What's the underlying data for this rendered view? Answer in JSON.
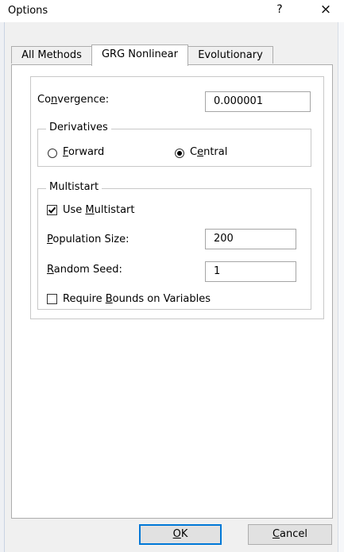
{
  "window": {
    "title": "Options",
    "help_label": "?",
    "close_label": "×"
  },
  "tabs": [
    {
      "label": "All Methods"
    },
    {
      "label": "GRG Nonlinear"
    },
    {
      "label": "Evolutionary"
    }
  ],
  "convergence": {
    "label_pre": "Co",
    "label_key": "n",
    "label_post": "vergence:",
    "value": "0.000001"
  },
  "derivatives": {
    "legend": "Derivatives",
    "forward": {
      "key": "F",
      "rest": "orward",
      "selected": false
    },
    "central": {
      "pre": "C",
      "key": "e",
      "rest": "ntral",
      "selected": true
    }
  },
  "multistart": {
    "legend": "Multistart",
    "use": {
      "pre": "Use ",
      "key": "M",
      "rest": "ultistart",
      "checked": true
    },
    "population": {
      "key": "P",
      "rest": "opulation Size:",
      "value": "200"
    },
    "seed": {
      "key": "R",
      "rest": "andom Seed:",
      "value": "1"
    },
    "bounds": {
      "pre": "Require ",
      "key": "B",
      "rest": "ounds on Variables",
      "checked": false
    }
  },
  "buttons": {
    "ok": {
      "key": "O",
      "rest": "K"
    },
    "cancel": {
      "key": "C",
      "rest": "ancel"
    }
  }
}
